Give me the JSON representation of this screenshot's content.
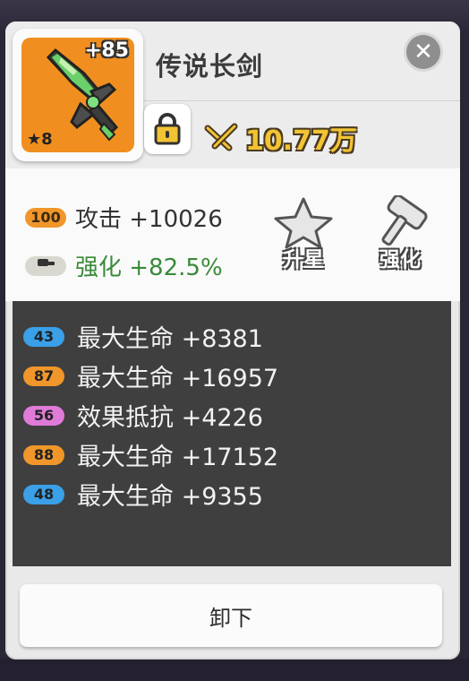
{
  "item": {
    "name": "传说长剑",
    "plus_level": "+85",
    "star_level": "★8",
    "power": "10.77万"
  },
  "main_stats": [
    {
      "badge": "100",
      "text": "攻击 +10026",
      "badge_color": "#f0962a",
      "text_color": "#333333"
    },
    {
      "badge_icon": "hammer-icon",
      "text": "强化 +82.5%",
      "badge_color": "#d8d8d0",
      "text_color": "#3a8a3a"
    }
  ],
  "actions": {
    "star_up_label": "升星",
    "enhance_label": "强化"
  },
  "sub_stats": [
    {
      "badge": "43",
      "text": "最大生命 +8381",
      "badge_color": "#3aa0e8"
    },
    {
      "badge": "87",
      "text": "最大生命 +16957",
      "badge_color": "#f0962a"
    },
    {
      "badge": "56",
      "text": "效果抵抗 +4226",
      "badge_color": "#e07ad8"
    },
    {
      "badge": "88",
      "text": "最大生命 +17152",
      "badge_color": "#f0962a"
    },
    {
      "badge": "48",
      "text": "最大生命 +9355",
      "badge_color": "#3aa0e8"
    }
  ],
  "unequip_label": "卸下",
  "close_icon": "close-icon",
  "lock_icon": "lock-icon",
  "power_icon": "crossed-swords-icon"
}
